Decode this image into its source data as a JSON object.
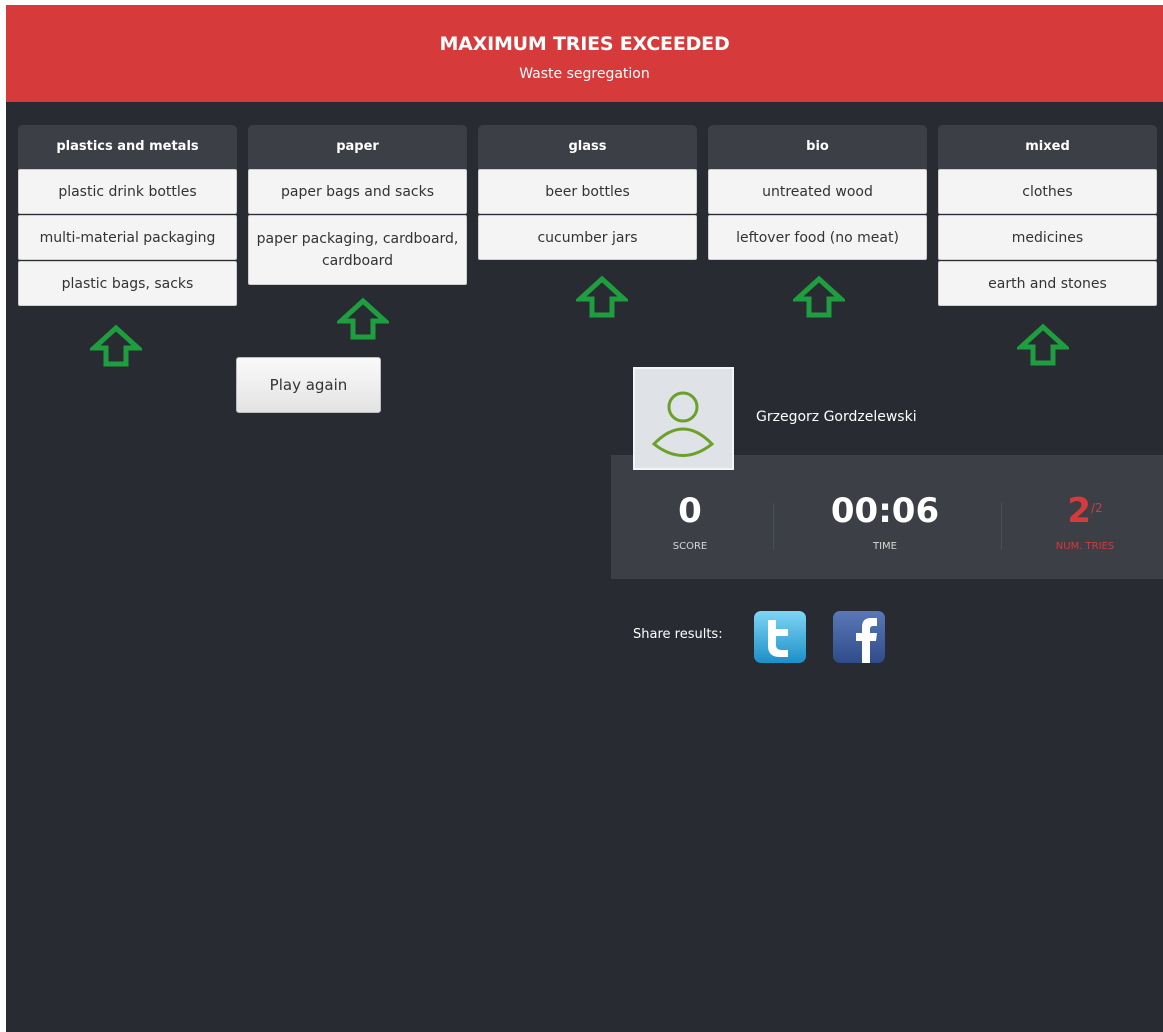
{
  "banner": {
    "title": "MAXIMUM TRIES EXCEEDED",
    "subtitle": "Waste segregation"
  },
  "columns": [
    {
      "name": "plastics and metals",
      "items": [
        "plastic drink bottles",
        "multi-material packaging",
        "plastic bags, sacks"
      ]
    },
    {
      "name": "paper",
      "items": [
        "paper bags and sacks",
        "paper packaging, cardboard, cardboard"
      ]
    },
    {
      "name": "glass",
      "items": [
        "beer bottles",
        "cucumber jars"
      ]
    },
    {
      "name": "bio",
      "items": [
        "untreated wood",
        "leftover food (no meat)"
      ]
    },
    {
      "name": "mixed",
      "items": [
        "clothes",
        "medicines",
        "earth and stones"
      ]
    }
  ],
  "play_again_label": "Play again",
  "player": {
    "name": "Grzegorz Gordzelewski",
    "avatar_icon": "user-icon"
  },
  "stats": {
    "score_value": "0",
    "score_label": "SCORE",
    "time_value": "00:06",
    "time_label": "TIME",
    "tries_value": "2",
    "tries_max": "/2",
    "tries_label": "NUM. TRIES"
  },
  "share": {
    "label": "Share results:",
    "twitter_icon": "twitter-icon",
    "facebook_icon": "facebook-icon"
  },
  "colors": {
    "banner": "#d63a3a",
    "background": "#282b32",
    "panel": "#3c3f46",
    "arrow": "#1e9e3e",
    "tries": "#d63a3a",
    "avatar_stroke": "#6aa12a"
  }
}
